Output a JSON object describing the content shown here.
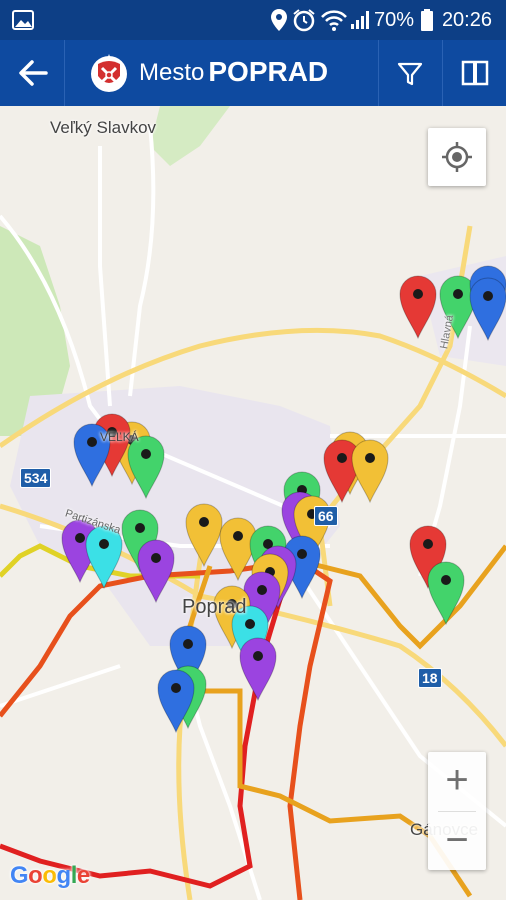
{
  "status_bar": {
    "time": "20:26",
    "battery_percent": "70%",
    "icons": [
      "image-icon",
      "location-icon",
      "alarm-icon",
      "wifi-icon",
      "signal-icon",
      "battery-icon"
    ]
  },
  "app_bar": {
    "prefix": "Mesto",
    "city": "POPRAD",
    "icons": [
      "back-arrow-icon",
      "city-crest-logo",
      "filter-icon",
      "book-icon"
    ]
  },
  "map": {
    "labels": {
      "town_velky_slavkov": "Veľký Slavkov",
      "district_velka": "VEĽKÁ",
      "city_poprad": "Poprad",
      "street_partizanska": "Partizánska",
      "street_hlavna": "Hlavná",
      "village_ganovce": "Gánovce"
    },
    "road_shields": {
      "r534": "534",
      "r66": "66",
      "r18": "18"
    },
    "controls": {
      "zoom_in": "+",
      "zoom_out": "−"
    },
    "attribution": "Google",
    "marker_colors": {
      "red": "#e53935",
      "green": "#43d36b",
      "blue": "#2f6fe0",
      "yellow": "#f2c036",
      "purple": "#9b44e0",
      "cyan": "#3be0e6"
    }
  }
}
